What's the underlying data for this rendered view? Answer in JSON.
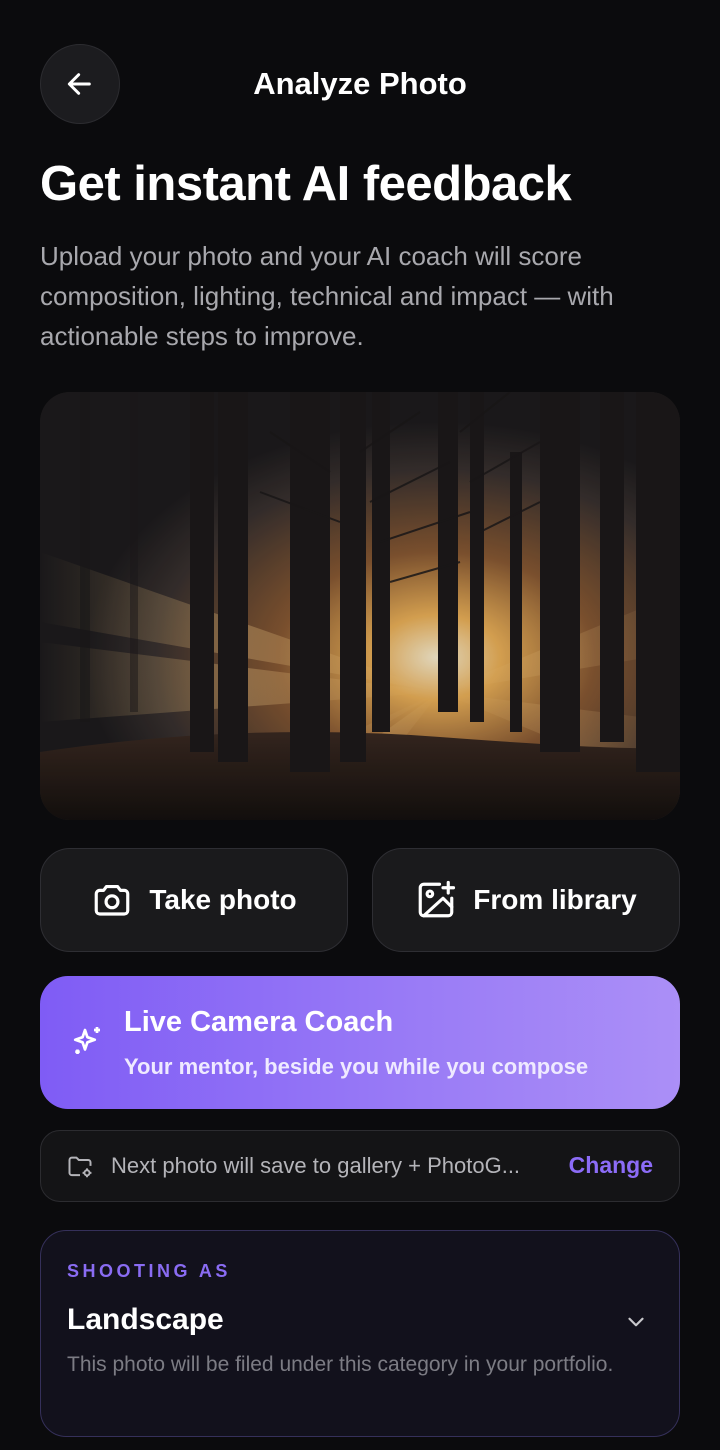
{
  "header": {
    "title": "Analyze Photo",
    "back_icon": "arrow-left-icon"
  },
  "intro": {
    "headline": "Get instant AI feedback",
    "description": "Upload your photo and your AI coach will score composition, lighting, technical and impact — with actionable steps to improve."
  },
  "photo": {
    "subject": "forest-sunbeams-image"
  },
  "actions": {
    "take_photo": {
      "label": "Take photo",
      "icon": "camera-icon"
    },
    "from_library": {
      "label": "From library",
      "icon": "image-add-icon"
    }
  },
  "live_coach": {
    "title": "Live Camera Coach",
    "subtitle": "Your mentor, beside you while you compose",
    "icon": "sparkles-icon",
    "gradient_start": "#7f5cf5",
    "gradient_end": "#ab8ff7"
  },
  "save_destination": {
    "text": "Next photo will save to gallery + PhotoG...",
    "change_label": "Change",
    "icon": "folder-settings-icon",
    "accent": "#8c6cf7"
  },
  "shooting_as": {
    "kicker": "SHOOTING AS",
    "value": "Landscape",
    "description": "This photo will be filed under this category in your portfolio.",
    "icon": "chevron-down-icon"
  },
  "colors": {
    "background": "#0b0b0d",
    "accent": "#8a6cf3"
  }
}
